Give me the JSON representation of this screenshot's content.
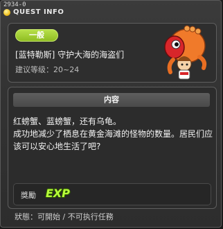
{
  "header": {
    "id_text": "2934-0",
    "title": "QUEST INFO"
  },
  "quest": {
    "category": "一般",
    "title": "[蓝特勒斯] 守护大海的海盗们",
    "level": "建议等级：20~24"
  },
  "content": {
    "heading": "内容",
    "lines": [
      "红螃蟹、蓝螃蟹，还有乌龟。",
      "成功地减少了栖息在黄金海滩的怪物的数量。居民们应该可以安心地生活了吧?"
    ]
  },
  "reward": {
    "label": "獎勵",
    "exp_label": "EXP"
  },
  "status": {
    "text": "狀態：可開始 / 不可执行任務"
  },
  "colors": {
    "category_badge": "#9fcd2e",
    "exp_text": "#b7ff3a",
    "panel_bg": "#2c2c2c"
  }
}
